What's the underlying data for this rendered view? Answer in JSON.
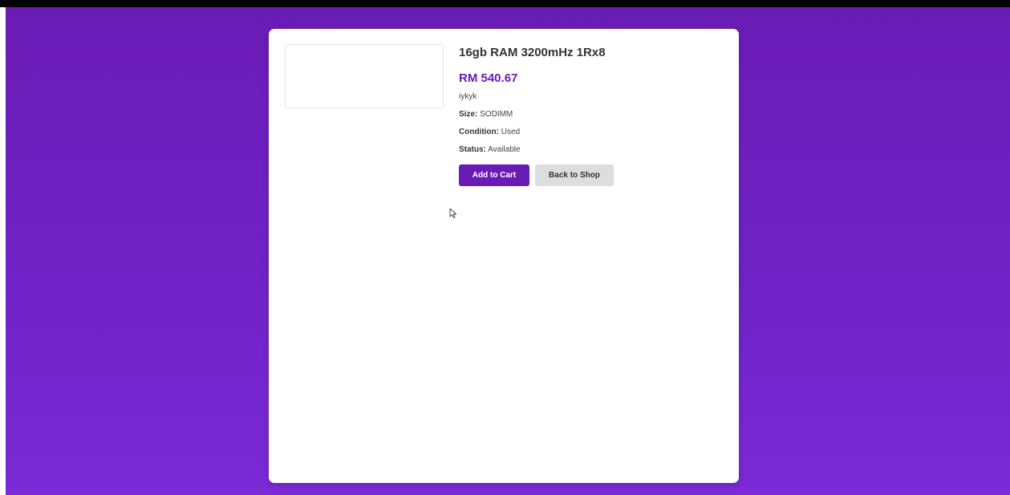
{
  "product": {
    "title": "16gb RAM 3200mHz 1Rx8",
    "price": "RM 540.67",
    "description": "iykyk",
    "attributes": [
      {
        "label": "Size:",
        "value": "SODIMM"
      },
      {
        "label": "Condition:",
        "value": "Used"
      },
      {
        "label": "Status:",
        "value": "Available"
      }
    ]
  },
  "actions": {
    "add_to_cart": "Add to Cart",
    "back_to_shop": "Back to Shop"
  },
  "colors": {
    "accent": "#6a1bb6",
    "background_gradient_top": "#6a1bb6",
    "background_gradient_bottom": "#7a2ad6",
    "secondary_button": "#dddddd"
  },
  "icons": {
    "cursor": "mouse-pointer-icon"
  }
}
